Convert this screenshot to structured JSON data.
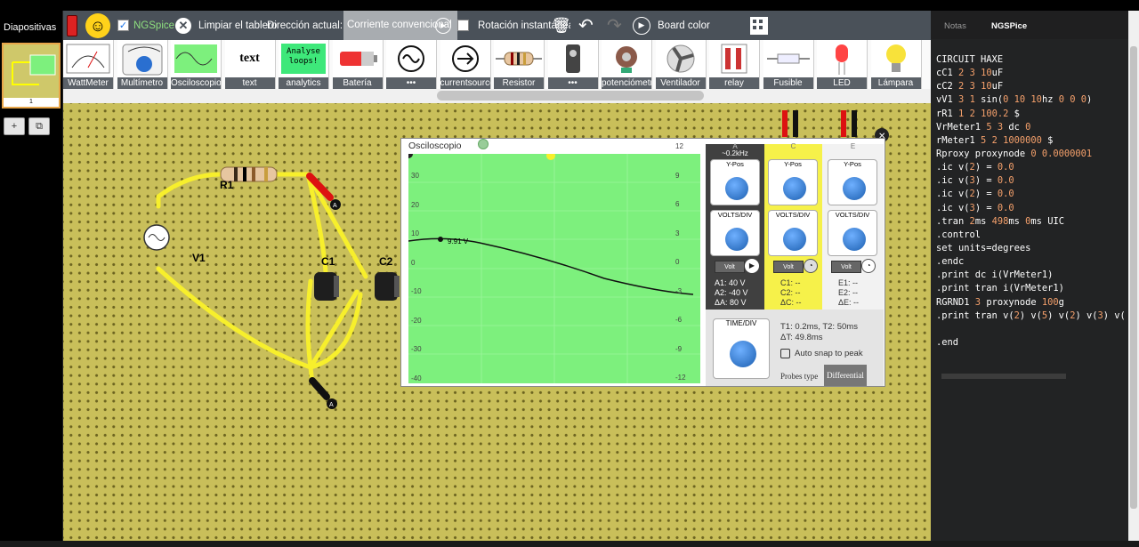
{
  "slides": {
    "title": "Diapositivas",
    "slide_number": "1",
    "add_label": "+",
    "copy_label": "⧉"
  },
  "toolbar": {
    "ngspice": "NGSpice",
    "clear": "Limpiar el tablero",
    "direction": "Dirección actual:",
    "current_value": "Corriente convencional",
    "rotation": "Rotación instantánea",
    "board_color": "Board color"
  },
  "palette": [
    {
      "label": "WattMeter",
      "icon": "wattmeter-icon"
    },
    {
      "label": "Multímetro",
      "icon": "multimeter-icon"
    },
    {
      "label": "Osciloscopio",
      "icon": "oscilloscope-icon"
    },
    {
      "label": "text",
      "icon": "text-icon",
      "text": "text"
    },
    {
      "label": "analytics",
      "icon": "analytics-icon",
      "text": "Analyse loops!"
    },
    {
      "label": "Batería",
      "icon": "battery-icon"
    },
    {
      "label": "•••",
      "icon": "ac-source-icon"
    },
    {
      "label": "currentsource",
      "icon": "current-source-icon"
    },
    {
      "label": "Resistor",
      "icon": "resistor-icon"
    },
    {
      "label": "•••",
      "icon": "switch-icon"
    },
    {
      "label": "potenciómetro",
      "icon": "potentiometer-icon"
    },
    {
      "label": "Ventilador",
      "icon": "fan-icon"
    },
    {
      "label": "relay",
      "icon": "relay-icon"
    },
    {
      "label": "Fusible",
      "icon": "fuse-icon"
    },
    {
      "label": "LED",
      "icon": "led-icon"
    },
    {
      "label": "Lámpara",
      "icon": "lamp-icon"
    }
  ],
  "circuit": {
    "r1": "R1",
    "v1": "V1",
    "c1": "C1",
    "c2": "C2",
    "probe_a": "A",
    "probe_c": "C",
    "probe_e": "E"
  },
  "oscilloscope": {
    "title": "Osciloscopio",
    "marker_value": "9.91 V",
    "y_left": [
      "30",
      "20",
      "10",
      "0",
      "-10",
      "-20",
      "-30",
      "-40"
    ],
    "y_right": [
      "12",
      "9",
      "6",
      "3",
      "0",
      "-3",
      "-6",
      "-9",
      "-12"
    ],
    "channel_a": {
      "label": "A",
      "freq": "~0.2kHz",
      "ypos": "Y-Pos",
      "voltsdiv": "VOLTS/DIV",
      "volt_btn": "Volt",
      "a1": "A1: 40 V",
      "a2": "A2: -40 V",
      "da": "ΔA: 80 V"
    },
    "channel_c": {
      "label": "C",
      "ypos": "Y-Pos",
      "voltsdiv": "VOLTS/DIV",
      "volt_btn": "Volt",
      "c1": "C1: --",
      "c2": "C2: --",
      "dc": "ΔC: --"
    },
    "channel_e": {
      "label": "E",
      "ypos": "Y-Pos",
      "voltsdiv": "VOLTS/DIV",
      "volt_btn": "Volt",
      "e1": "E1: --",
      "e2": "E2: --",
      "de": "ΔE: --"
    },
    "timediv": "TIME/DIV",
    "t_info": "T1: 0.2ms, T2: 50ms",
    "dt": "ΔT: 49.8ms",
    "autosnap": "Auto snap to peak",
    "probes_type": "Probes type",
    "probes_value": "Differential"
  },
  "right": {
    "tab_notes": "Notas",
    "tab_ngspice": "NGSPice"
  },
  "netlist": [
    "CIRCUIT HAXE",
    "cC1 2 3 10uF",
    "cC2 2 3 10uF",
    "vV1 3 1 sin(0 10 10hz 0 0 0)",
    "rR1 1 2 100.2 $",
    "VrMeter1 5 3 dc 0",
    "rMeter1 5 2 1000000 $",
    "Rproxy proxynode 0 0.0000001",
    ".ic v(2) = 0.0",
    ".ic v(3) = 0.0",
    ".ic v(2) = 0.0",
    ".ic v(3) = 0.0",
    ".tran 2ms 498ms 0ms UIC",
    ".control",
    "set units=degrees",
    ".endc",
    ".print dc i(VrMeter1)",
    ".print tran i(VrMeter1)",
    "RGRND1 3 proxynode 100g",
    ".print tran v(2) v(5) v(2) v(3) v(",
    "",
    ".end"
  ]
}
